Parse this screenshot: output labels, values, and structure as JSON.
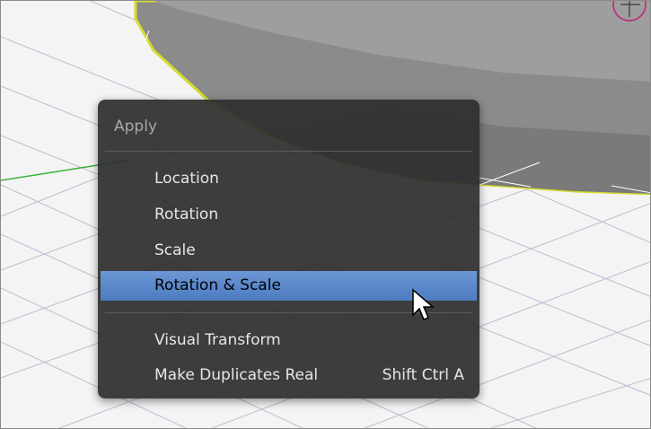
{
  "menu": {
    "title": "Apply",
    "items": [
      {
        "label": "Location",
        "shortcut": ""
      },
      {
        "label": "Rotation",
        "shortcut": ""
      },
      {
        "label": "Scale",
        "shortcut": ""
      },
      {
        "label": "Rotation & Scale",
        "shortcut": "",
        "highlighted": true
      },
      {
        "label": "Visual Transform",
        "shortcut": ""
      },
      {
        "label": "Make Duplicates Real",
        "shortcut": "Shift Ctrl A"
      }
    ]
  },
  "colors": {
    "menu_background": "#2e2e2e",
    "highlight": "#5a87cb",
    "selection_outline": "#d7e030",
    "grid_line": "#b4b4cc",
    "x_axis": "#cc3333",
    "y_axis": "#33aa33"
  }
}
